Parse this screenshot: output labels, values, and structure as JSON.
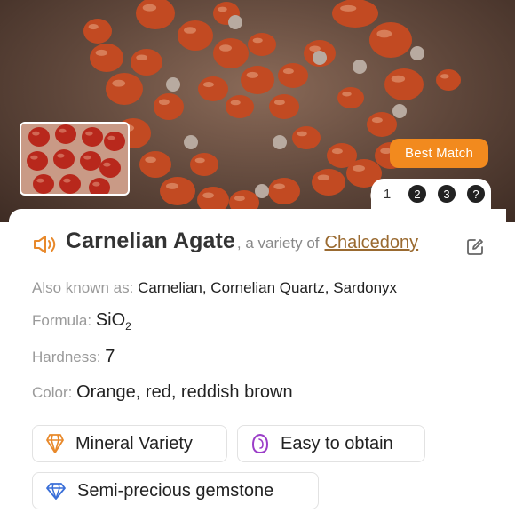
{
  "hero": {
    "photo_description_icon": "carnelian-bead-necklace-photo",
    "badge": "Best Match",
    "pages": [
      "1",
      "2",
      "3",
      "?"
    ],
    "active_page": "1"
  },
  "stone": {
    "name": "Carnelian Agate",
    "variety_prefix": ", a variety of",
    "parent": "Chalcedony"
  },
  "properties": {
    "aka_label": "Also known as:",
    "aka_value": "Carnelian, Cornelian Quartz, Sardonyx",
    "formula_label": "Formula:",
    "formula_main": "SiO",
    "formula_sub": "2",
    "hardness_label": "Hardness:",
    "hardness_value": "7",
    "color_label": "Color:",
    "color_value": "Orange, red, reddish brown"
  },
  "tags": [
    {
      "label": "Mineral Variety",
      "icon": "crystal-icon",
      "color": "#e8892b"
    },
    {
      "label": "Easy to obtain",
      "icon": "stone-icon",
      "color": "#9b3dc8"
    },
    {
      "label": "Semi-precious gemstone",
      "icon": "diamond-icon",
      "color": "#3a6fd8"
    }
  ],
  "colors": {
    "accent": "#f28a1e",
    "link": "#9a6a30"
  }
}
